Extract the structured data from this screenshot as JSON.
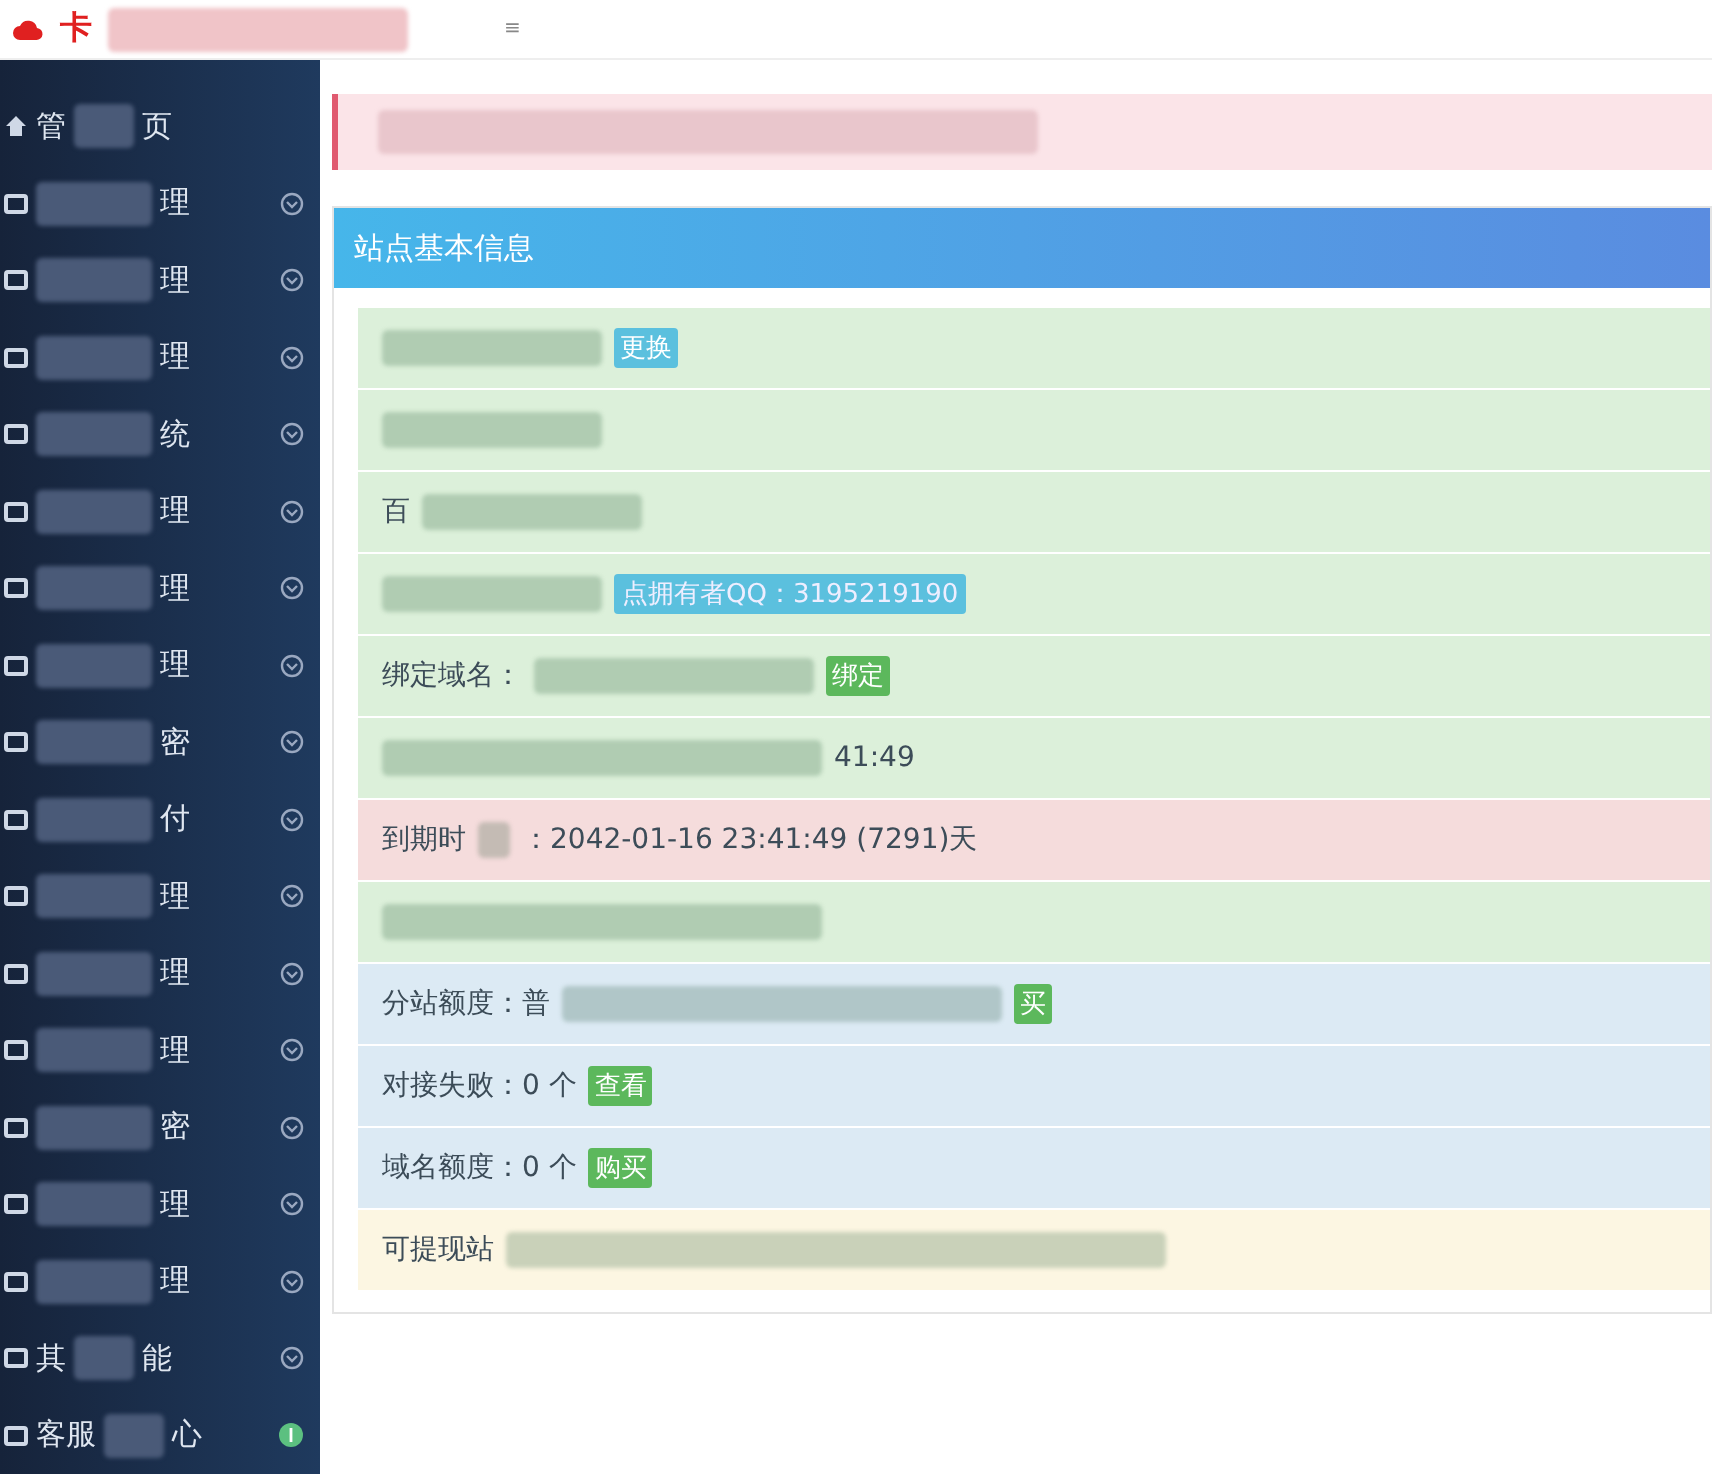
{
  "header": {
    "logo_text": "卡",
    "menu_mark": "≡"
  },
  "sidebar": {
    "items": [
      {
        "kind": "home",
        "prefix": "管",
        "suffix": "页"
      },
      {
        "kind": "group",
        "suffix": "理"
      },
      {
        "kind": "group",
        "suffix": "理"
      },
      {
        "kind": "group",
        "suffix": "理"
      },
      {
        "kind": "group",
        "suffix": "统"
      },
      {
        "kind": "group",
        "suffix": "理"
      },
      {
        "kind": "group",
        "suffix": "理"
      },
      {
        "kind": "group",
        "suffix": "理"
      },
      {
        "kind": "group",
        "suffix": "密"
      },
      {
        "kind": "group",
        "suffix": "付"
      },
      {
        "kind": "group",
        "suffix": "理"
      },
      {
        "kind": "group",
        "suffix": "理"
      },
      {
        "kind": "group",
        "suffix": "理"
      },
      {
        "kind": "group",
        "suffix": "密"
      },
      {
        "kind": "group",
        "suffix": "理"
      },
      {
        "kind": "group",
        "suffix": "理"
      },
      {
        "kind": "group",
        "prefix": "其",
        "suffix": "能"
      },
      {
        "kind": "support",
        "prefix": "客服",
        "suffix": "心"
      }
    ]
  },
  "panel": {
    "title": "站点基本信息",
    "rows": [
      {
        "color": "#dcf0da",
        "segments": [
          {
            "kind": "redacted"
          },
          {
            "kind": "button",
            "label": "更换",
            "color": "#5bc0de"
          }
        ]
      },
      {
        "color": "#dcf0da",
        "segments": [
          {
            "kind": "redacted"
          }
        ]
      },
      {
        "color": "#dcf0da",
        "segments": [
          {
            "kind": "text",
            "text": "百"
          },
          {
            "kind": "redacted"
          }
        ]
      },
      {
        "color": "#dcf0da",
        "segments": [
          {
            "kind": "redacted"
          },
          {
            "kind": "tag",
            "text": "点拥有者QQ：3195219190",
            "color": "#5bc0de"
          }
        ]
      },
      {
        "color": "#dcf0da",
        "segments": [
          {
            "kind": "text",
            "text": "绑定域名："
          },
          {
            "kind": "redacted"
          },
          {
            "kind": "button",
            "label": "绑定",
            "color": "#5cb85c"
          }
        ]
      },
      {
        "color": "#dcf0da",
        "segments": [
          {
            "kind": "redacted"
          },
          {
            "kind": "text",
            "text": "41:49"
          }
        ]
      },
      {
        "color": "#f5dcdc",
        "segments": [
          {
            "kind": "text",
            "text": "到期时"
          },
          {
            "kind": "redacted"
          },
          {
            "kind": "text",
            "text": "：2042-01-16 23:41:49 (7291)天"
          }
        ]
      },
      {
        "color": "#dcf0da",
        "segments": [
          {
            "kind": "redacted"
          }
        ]
      },
      {
        "color": "#dceaf4",
        "segments": [
          {
            "kind": "text",
            "text": "分站额度：普"
          },
          {
            "kind": "redacted"
          },
          {
            "kind": "button",
            "label": "买",
            "color": "#5cb85c"
          }
        ]
      },
      {
        "color": "#dceaf4",
        "segments": [
          {
            "kind": "text",
            "text": "对接失败：0 个"
          },
          {
            "kind": "button",
            "label": "查看",
            "color": "#5cb85c"
          }
        ]
      },
      {
        "color": "#dceaf4",
        "segments": [
          {
            "kind": "text",
            "text": "域名额度：0 个"
          },
          {
            "kind": "button",
            "label": "购买",
            "color": "#5cb85c"
          }
        ]
      },
      {
        "color": "#fcf6e2",
        "segments": [
          {
            "kind": "text",
            "text": "可提现站"
          },
          {
            "kind": "redacted"
          }
        ]
      }
    ]
  }
}
